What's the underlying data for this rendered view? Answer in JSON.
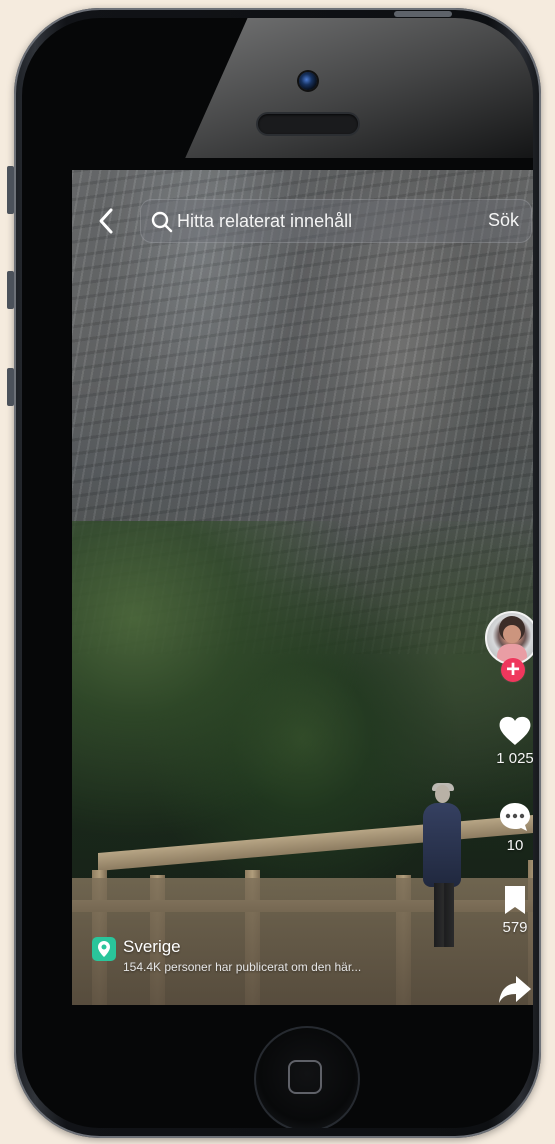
{
  "search": {
    "placeholder": "Hitta relaterat innehåll",
    "button_label": "Sök"
  },
  "actions": {
    "likes": "1 025",
    "comments": "10",
    "saves": "579"
  },
  "location": {
    "name": "Sverige",
    "subtitle": "154.4K personer har publicerat om den här..."
  },
  "icons": {
    "back": "back-icon",
    "search": "search-icon",
    "like": "heart-icon",
    "comment": "comment-icon",
    "save": "bookmark-icon",
    "share": "share-icon",
    "location": "location-pin-icon",
    "home": "home-button-icon"
  },
  "colors": {
    "accent": "#ef375d",
    "location": "#2ac59b",
    "text": "#ffffff",
    "background": "#f5ebde"
  }
}
